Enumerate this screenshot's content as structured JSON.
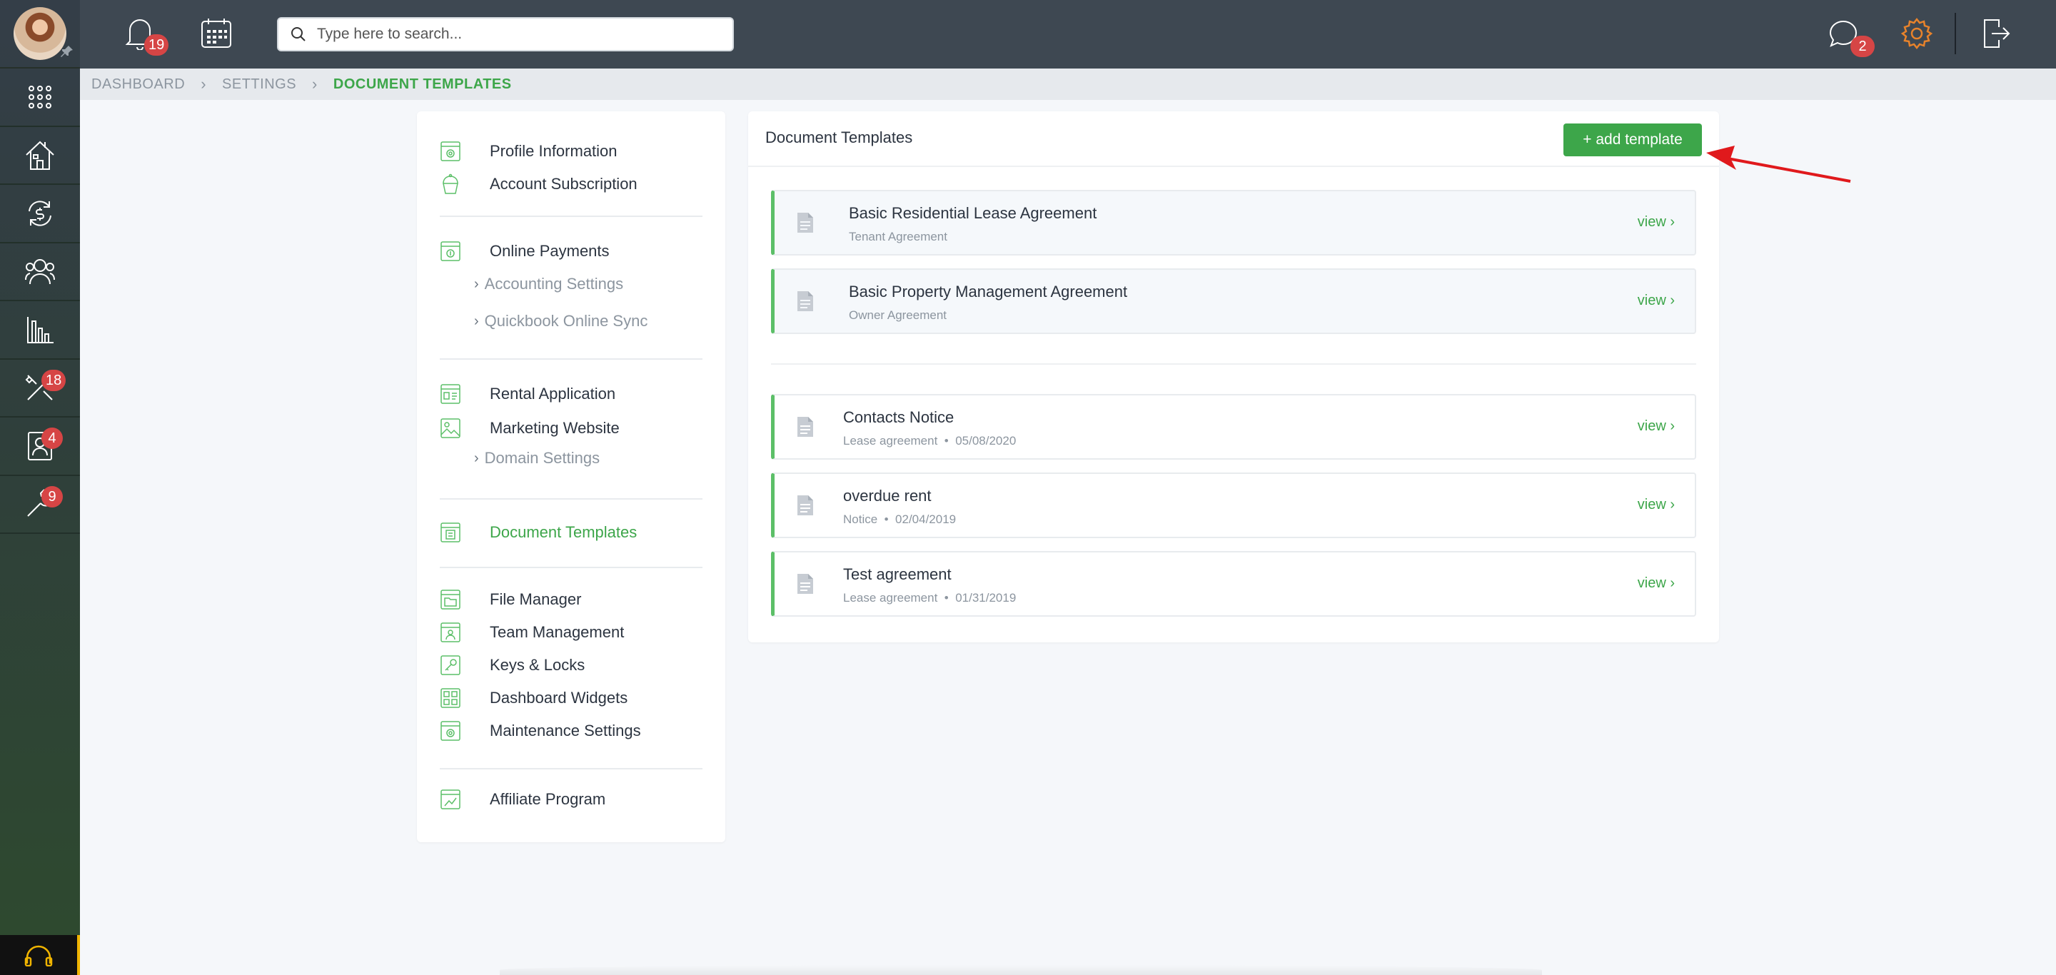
{
  "header": {
    "notifications_count": "19",
    "messages_count": "2",
    "search_placeholder": "Type here to search..."
  },
  "rail": {
    "badges": {
      "maintenance": "18",
      "tenants": "4",
      "tools": "9"
    }
  },
  "breadcrumb": [
    "DASHBOARD",
    "SETTINGS",
    "DOCUMENT TEMPLATES"
  ],
  "settings_nav": {
    "profile_information": "Profile Information",
    "account_subscription": "Account Subscription",
    "online_payments": "Online Payments",
    "accounting_settings": "Accounting Settings",
    "quickbook_online_sync": "Quickbook Online Sync",
    "rental_application": "Rental Application",
    "marketing_website": "Marketing Website",
    "domain_settings": "Domain Settings",
    "document_templates": "Document Templates",
    "file_manager": "File Manager",
    "team_management": "Team Management",
    "keys_locks": "Keys & Locks",
    "dashboard_widgets": "Dashboard Widgets",
    "maintenance_settings": "Maintenance Settings",
    "affiliate_program": "Affiliate Program"
  },
  "main": {
    "title": "Document Templates",
    "add_button": "+ add template",
    "view_label": "view",
    "default_templates": [
      {
        "name": "Basic Residential Lease Agreement",
        "meta": "Tenant Agreement"
      },
      {
        "name": "Basic Property Management Agreement",
        "meta": "Owner Agreement"
      }
    ],
    "custom_templates": [
      {
        "name": "Contacts Notice",
        "type": "Lease agreement",
        "date": "05/08/2020"
      },
      {
        "name": "overdue rent",
        "type": "Notice",
        "date": "02/04/2019"
      },
      {
        "name": "Test agreement",
        "type": "Lease agreement",
        "date": "01/31/2019"
      }
    ]
  },
  "colors": {
    "accent": "#3da64a",
    "badge": "#d64545",
    "topbar": "#3e4852",
    "annotation_arrow": "#e0191c",
    "settings_icon": "#e8832b"
  }
}
